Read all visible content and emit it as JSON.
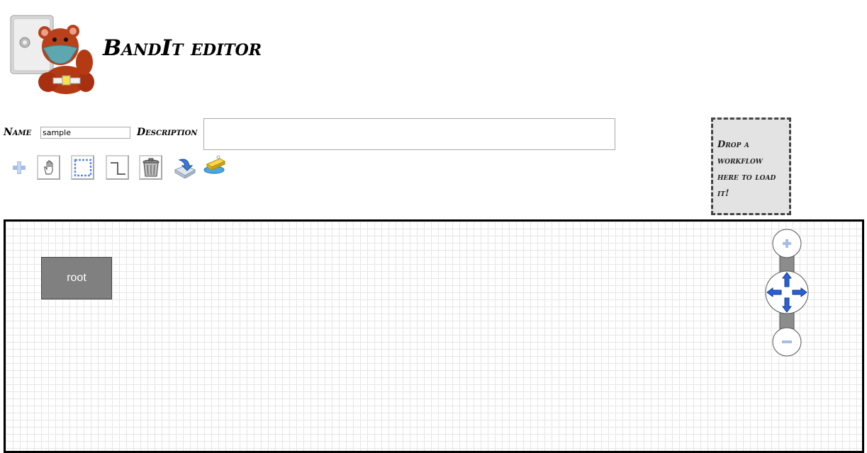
{
  "header": {
    "title": "BandIt editor",
    "logo_icon": "bear-robber-logo-icon"
  },
  "form": {
    "name_label": "Name",
    "name_value": "sample",
    "description_label": "Description",
    "description_value": ""
  },
  "toolbar": {
    "tools": [
      "add-icon",
      "hand-pan-icon",
      "select-rect-icon",
      "connector-icon",
      "trash-icon",
      "save-disk-icon",
      "soap-clean-icon"
    ]
  },
  "dropzone": {
    "text": "Drop a workflow here to load it!"
  },
  "canvas": {
    "nodes": [
      {
        "label": "root"
      }
    ],
    "nav": {
      "zoom_in": "+",
      "zoom_out": "−"
    }
  },
  "colors": {
    "node_fill": "#808080",
    "grid": "#e6e6e6",
    "dropzone_bg": "#e3e3e3",
    "arrow_blue": "#2a5fd6"
  }
}
